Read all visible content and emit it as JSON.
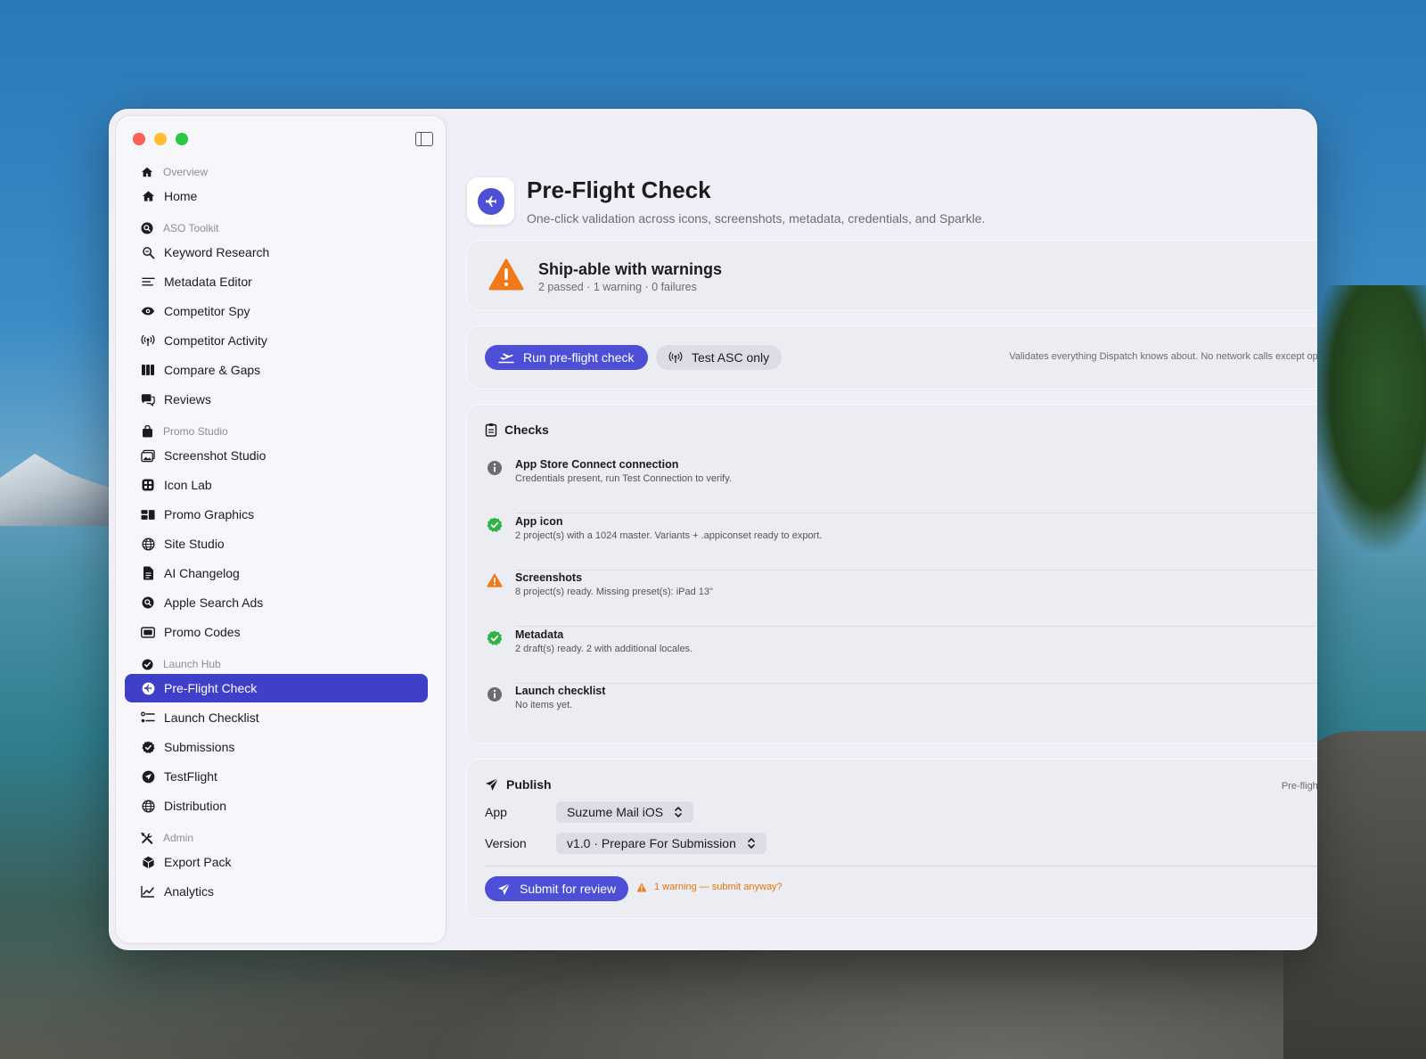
{
  "sidebar": {
    "groups": [
      {
        "label": "Overview",
        "icon": "house-icon",
        "items": [
          {
            "label": "Home",
            "icon": "house-icon"
          }
        ]
      },
      {
        "label": "ASO Toolkit",
        "icon": "magnifier-circle-icon",
        "items": [
          {
            "label": "Keyword Research",
            "icon": "magnifier-icon"
          },
          {
            "label": "Metadata Editor",
            "icon": "text-lines-icon"
          },
          {
            "label": "Competitor Spy",
            "icon": "eye-icon"
          },
          {
            "label": "Competitor Activity",
            "icon": "antenna-icon"
          },
          {
            "label": "Compare & Gaps",
            "icon": "columns-icon"
          },
          {
            "label": "Reviews",
            "icon": "speech-bubbles-icon"
          }
        ]
      },
      {
        "label": "Promo Studio",
        "icon": "bag-icon",
        "items": [
          {
            "label": "Screenshot Studio",
            "icon": "photo-stack-icon"
          },
          {
            "label": "Icon Lab",
            "icon": "app-grid-icon"
          },
          {
            "label": "Promo Graphics",
            "icon": "rectangles-icon"
          },
          {
            "label": "Site Studio",
            "icon": "globe-icon"
          },
          {
            "label": "AI Changelog",
            "icon": "document-icon"
          },
          {
            "label": "Apple Search Ads",
            "icon": "magnifier-circle-icon"
          },
          {
            "label": "Promo Codes",
            "icon": "ticket-icon"
          }
        ]
      },
      {
        "label": "Launch Hub",
        "icon": "checkmark-circle-icon",
        "items": [
          {
            "label": "Pre-Flight Check",
            "icon": "airplane-circle-icon",
            "active": true
          },
          {
            "label": "Launch Checklist",
            "icon": "checklist-icon"
          },
          {
            "label": "Submissions",
            "icon": "checkmark-seal-icon"
          },
          {
            "label": "TestFlight",
            "icon": "paperplane-circle-icon"
          },
          {
            "label": "Distribution",
            "icon": "globe-icon"
          }
        ]
      },
      {
        "label": "Admin",
        "icon": "tools-icon",
        "items": [
          {
            "label": "Export Pack",
            "icon": "cube-icon"
          },
          {
            "label": "Analytics",
            "icon": "chart-line-icon"
          }
        ]
      }
    ]
  },
  "header": {
    "title": "Pre-Flight Check",
    "subtitle": "One-click validation across icons, screenshots, metadata, credentials, and Sparkle."
  },
  "status": {
    "title": "Ship-able with warnings",
    "summary": "2 passed · 1 warning · 0 failures"
  },
  "actions": {
    "run_label": "Run pre-flight check",
    "test_label": "Test ASC only",
    "note": "Validates everything Dispatch knows about. No network calls except optional ASC test."
  },
  "checks": {
    "title": "Checks",
    "items": [
      {
        "name": "App Store Connect connection",
        "detail": "Credentials present, run Test Connection to verify.",
        "state": "info"
      },
      {
        "name": "App icon",
        "detail": "2 project(s) with a 1024 master. Variants + .appiconset ready to export.",
        "state": "pass"
      },
      {
        "name": "Screenshots",
        "detail": "8 project(s) ready. Missing preset(s): iPad 13\"",
        "state": "warning"
      },
      {
        "name": "Metadata",
        "detail": "2 draft(s) ready. 2 with additional locales.",
        "state": "pass"
      },
      {
        "name": "Launch checklist",
        "detail": "No items yet.",
        "state": "info"
      }
    ]
  },
  "publish": {
    "title": "Publish",
    "flow_label": "Pre-flight → submission",
    "app_label": "App",
    "app_value": "Suzume Mail iOS",
    "version_label": "Version",
    "version_value": "v1.0 · Prepare For Submission",
    "submit_label": "Submit for review",
    "warning_text": "1 warning — submit anyway?"
  },
  "colors": {
    "accent": "#4d4fd6",
    "active_nav": "#3f3fc9",
    "warning": "#e8740c",
    "success": "#2fb344",
    "info": "#6b6b70"
  }
}
